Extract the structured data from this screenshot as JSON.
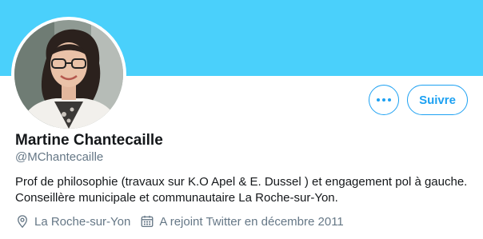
{
  "profile": {
    "display_name": "Martine Chantecaille",
    "handle": "@MChantecaille",
    "bio_lines": [
      "Prof de philosophie (travaux sur K.O Apel & E. Dussel ) et engagement pol à gauche.",
      "Conseillère municipale et communautaire La Roche-sur-Yon."
    ],
    "location": "La Roche-sur-Yon",
    "joined": "A rejoint Twitter en décembre 2011"
  },
  "actions": {
    "more_icon": "more-horizontal-icon",
    "follow_label": "Suivre"
  },
  "icons": {
    "location": "location-pin-icon",
    "joined": "calendar-icon"
  },
  "colors": {
    "banner": "#4ad0fb",
    "accent": "#1da1f2",
    "text_primary": "#14171a",
    "text_secondary": "#657786"
  }
}
